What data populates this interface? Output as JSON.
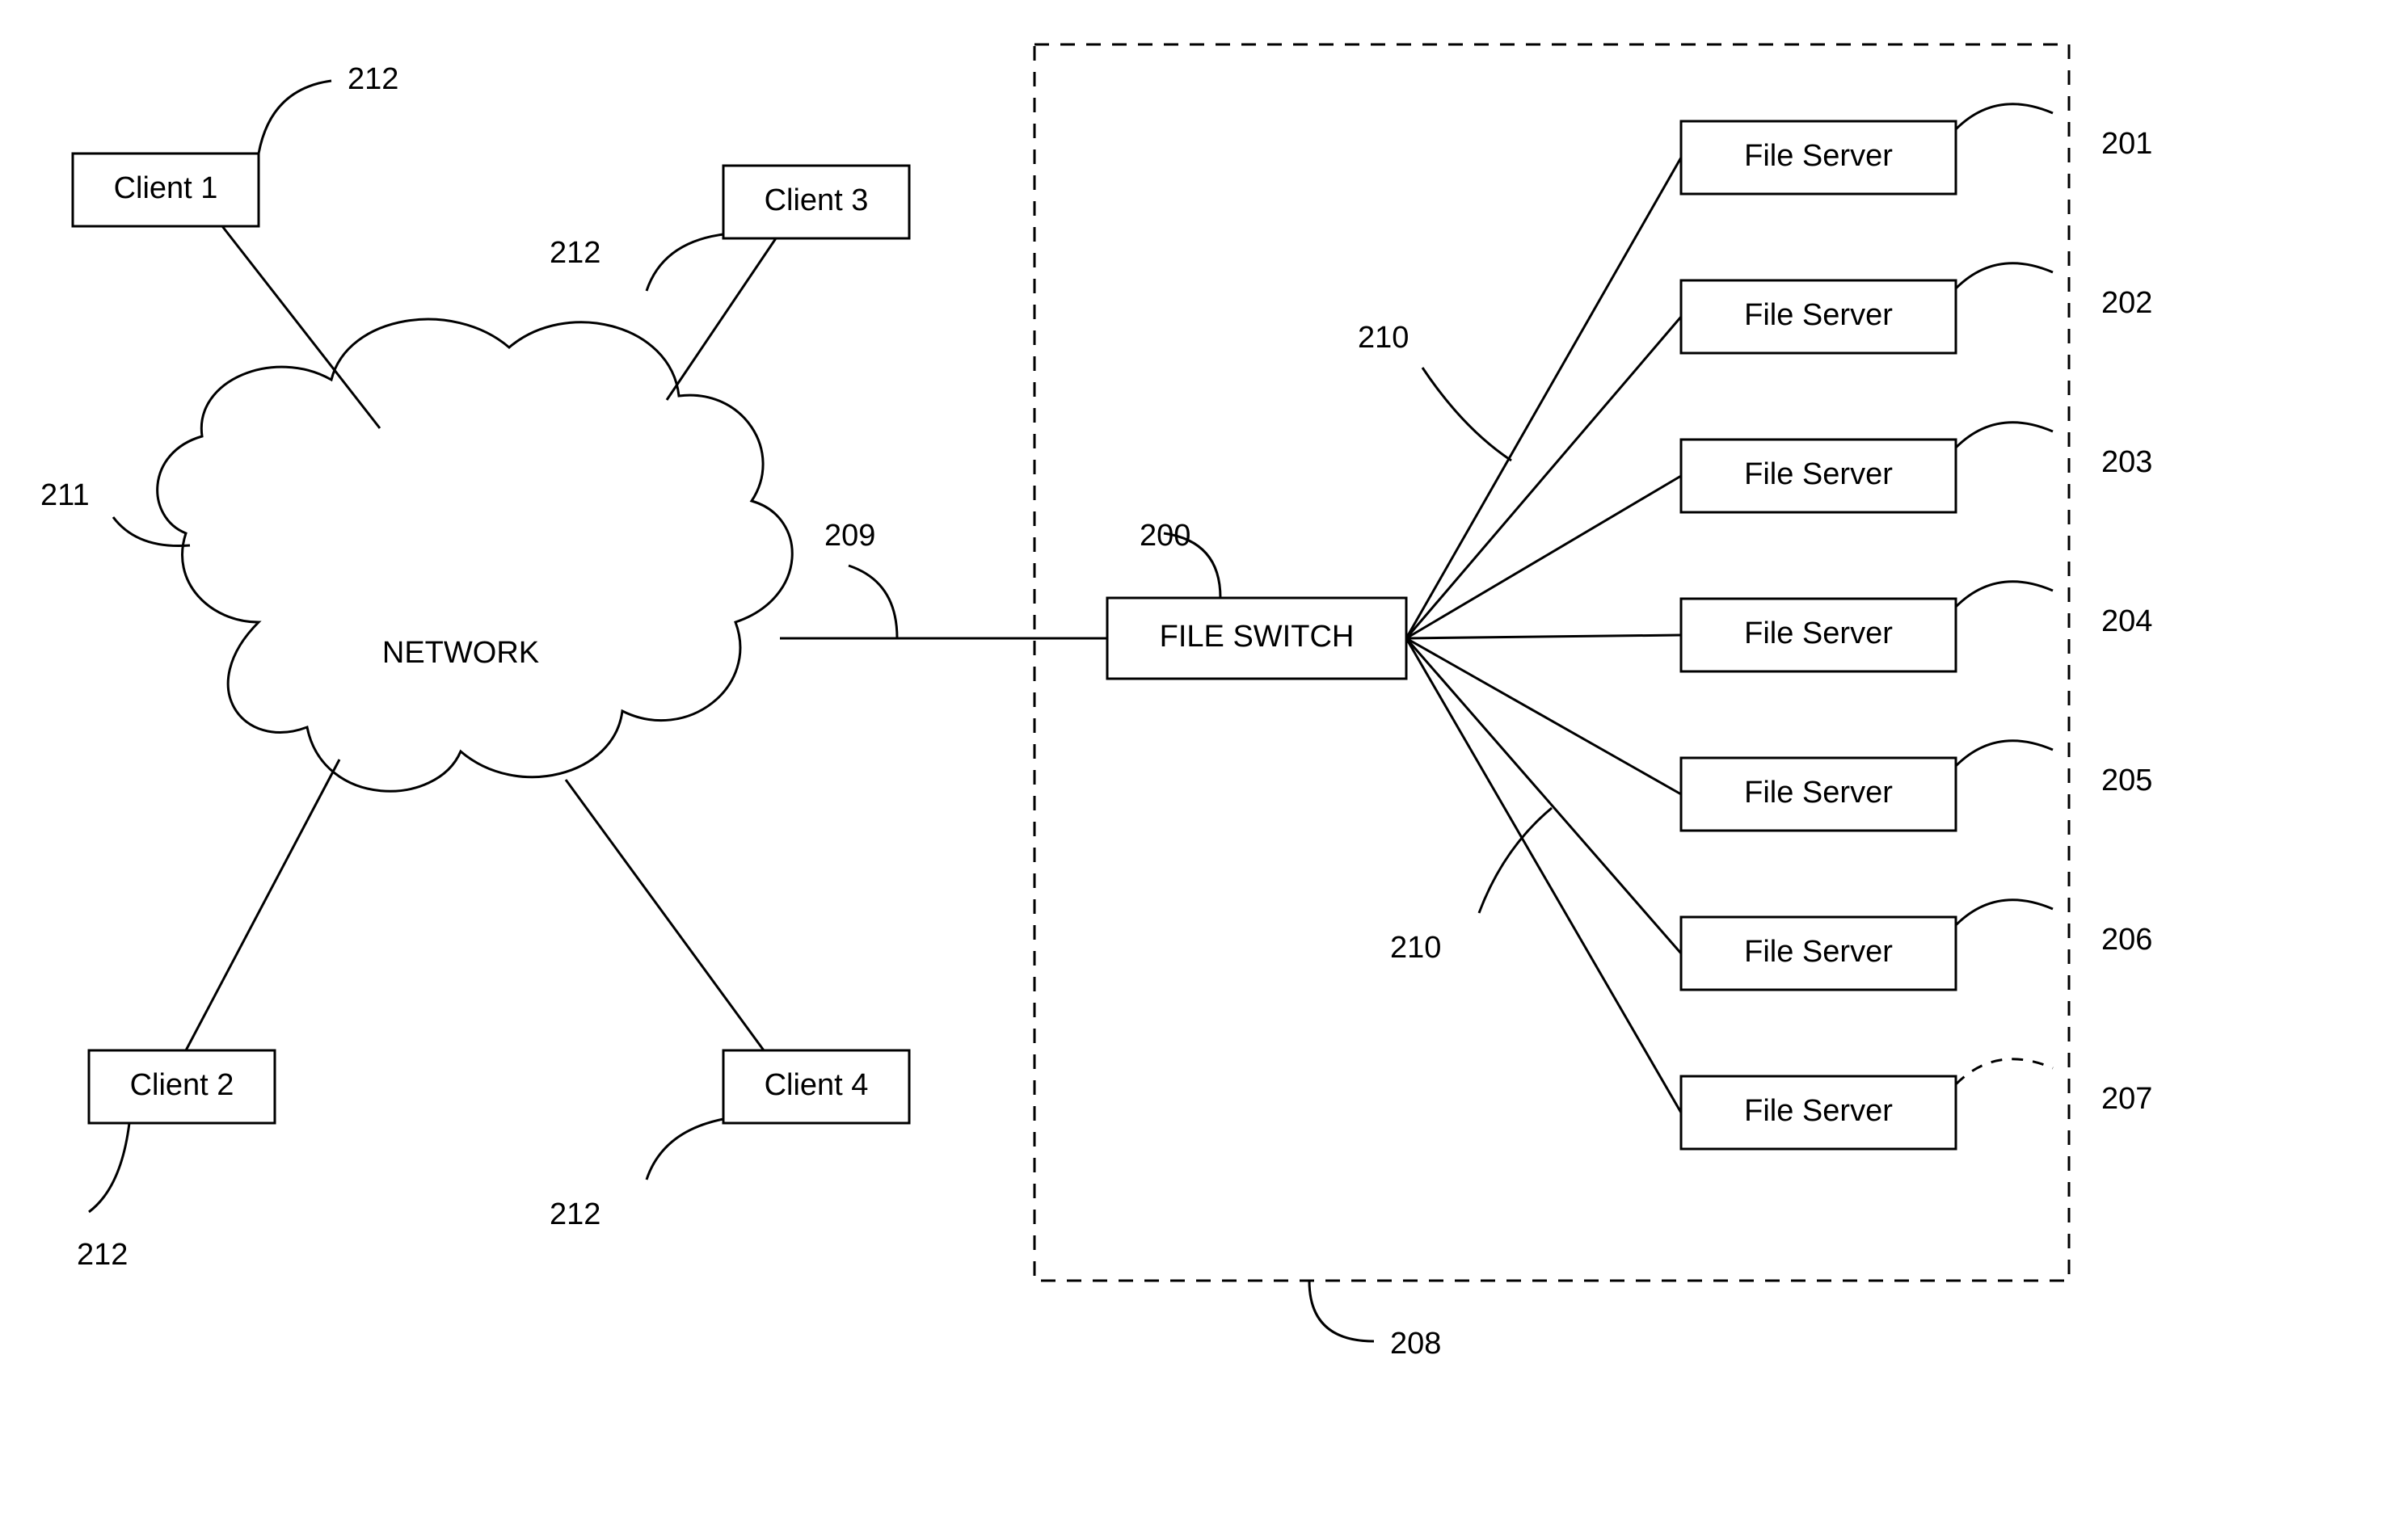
{
  "clients": {
    "c1": {
      "label": "Client 1",
      "ref": "212"
    },
    "c2": {
      "label": "Client 2",
      "ref": "212"
    },
    "c3": {
      "label": "Client 3",
      "ref": "212"
    },
    "c4": {
      "label": "Client 4",
      "ref": "212"
    }
  },
  "network": {
    "label": "NETWORK",
    "ref": "211",
    "link_ref": "209"
  },
  "switch": {
    "label": "FILE SWITCH",
    "ref": "200",
    "links_ref": "210"
  },
  "servers": {
    "s1": {
      "label": "File Server",
      "ref": "201"
    },
    "s2": {
      "label": "File Server",
      "ref": "202"
    },
    "s3": {
      "label": "File Server",
      "ref": "203"
    },
    "s4": {
      "label": "File Server",
      "ref": "204"
    },
    "s5": {
      "label": "File Server",
      "ref": "205"
    },
    "s6": {
      "label": "File Server",
      "ref": "206"
    },
    "s7": {
      "label": "File Server",
      "ref": "207"
    }
  },
  "group_ref": "208"
}
